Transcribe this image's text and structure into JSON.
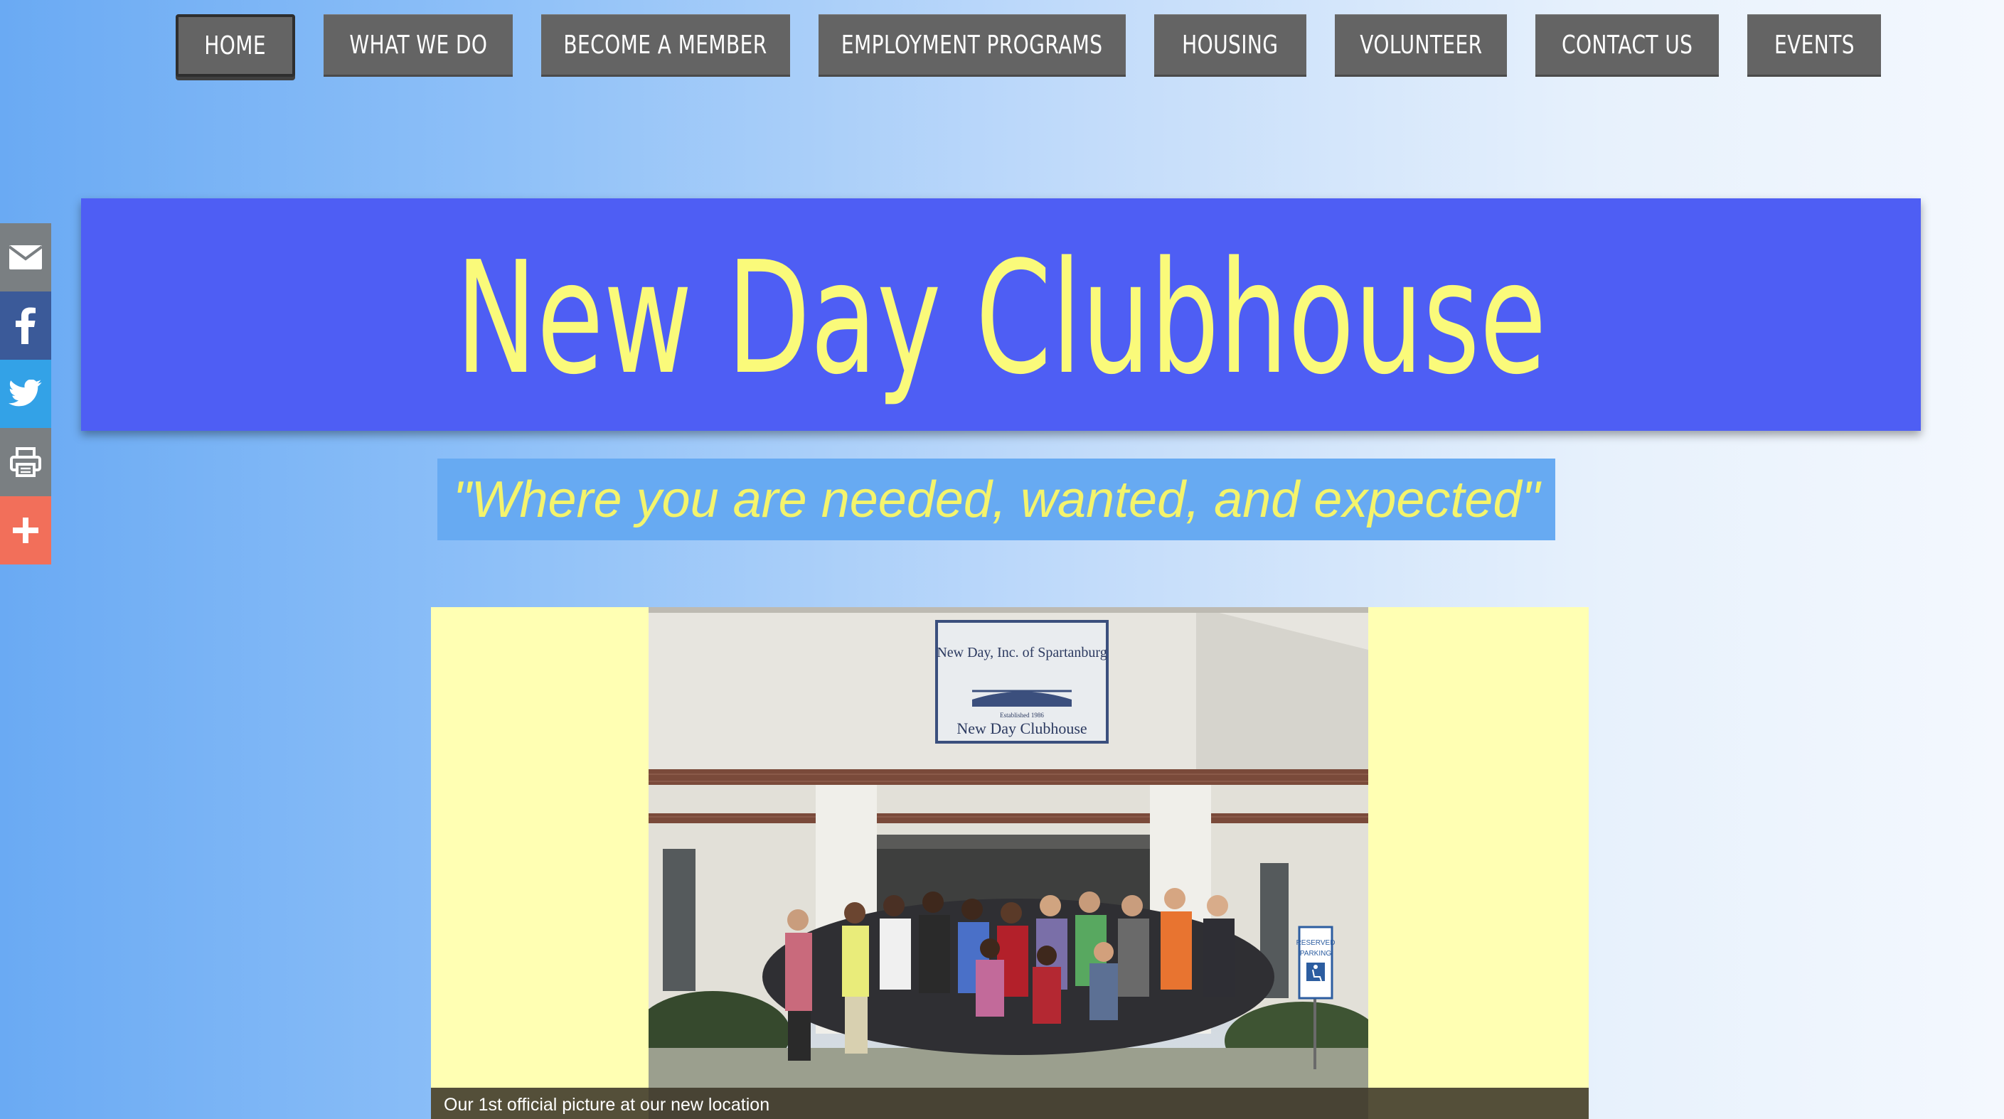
{
  "nav": {
    "items": [
      {
        "label": "HOME",
        "active": true
      },
      {
        "label": "WHAT WE DO"
      },
      {
        "label": "BECOME A MEMBER"
      },
      {
        "label": "EMPLOYMENT PROGRAMS"
      },
      {
        "label": "HOUSING"
      },
      {
        "label": "VOLUNTEER"
      },
      {
        "label": "CONTACT US"
      },
      {
        "label": "EVENTS"
      }
    ]
  },
  "share": {
    "buttons": [
      {
        "icon": "envelope-icon",
        "color": "#7a7f82"
      },
      {
        "icon": "facebook-icon",
        "color": "#3b5a99"
      },
      {
        "icon": "twitter-icon",
        "color": "#33a2e7"
      },
      {
        "icon": "print-icon",
        "color": "#7a7f82"
      },
      {
        "icon": "plus-icon",
        "color": "#f26f5a"
      }
    ]
  },
  "banner": {
    "title": "New Day Clubhouse"
  },
  "tagline": "\"Where you are needed, wanted, and expected\"",
  "slideshow": {
    "sign_lines": [
      "New Day, Inc. of Spartanburg",
      "Established 1986",
      "New Day Clubhouse"
    ],
    "parking_sign": [
      "RESERVED",
      "PARKING"
    ],
    "caption": "Our 1st official picture at our new location"
  },
  "colors": {
    "banner_bg": "#4e5ef4",
    "title_yellow": "#fafa7a",
    "tagline_bg": "#67aaf2",
    "nav_bg": "#646464",
    "slideshow_bg": "#ffffb3"
  }
}
